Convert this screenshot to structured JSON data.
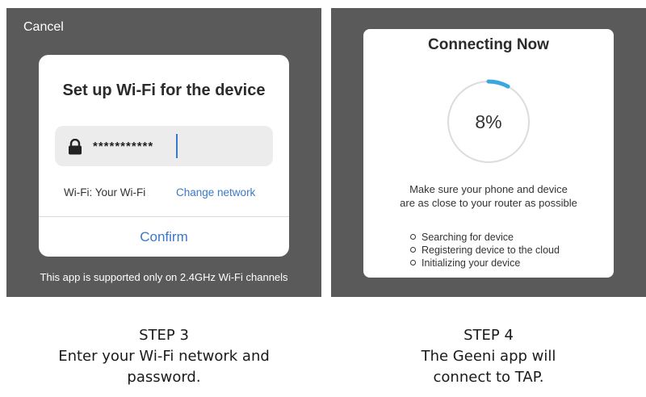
{
  "step3": {
    "cancel_label": "Cancel",
    "dialog_title": "Set up Wi-Fi for the device",
    "password_masked": "***********",
    "wifi_label": "Wi-Fi: Your Wi-Fi",
    "change_network_label": "Change network",
    "confirm_label": "Confirm",
    "footnote": "This app is supported only on 2.4GHz Wi-Fi channels"
  },
  "step4": {
    "title": "Connecting Now",
    "progress_text": "8%",
    "progress_value": 8,
    "note_line1": "Make sure your phone and device",
    "note_line2": "are as close to your router as possible",
    "steps": [
      "Searching for device",
      "Registering device to the cloud",
      "Initializing your device"
    ]
  },
  "captions": {
    "left_step": "STEP 3",
    "left_text": "Enter your Wi-Fi network and password.",
    "right_step": "STEP 4",
    "right_text": "The Geeni app will connect to TAP."
  },
  "colors": {
    "panel_bg": "#5a5a5a",
    "accent_blue": "#3a78c9",
    "progress_arc": "#3aa7e0",
    "progress_track": "#dcdcdc"
  },
  "icons": {
    "lock": "lock-icon",
    "bullet": "circle-bullet-icon"
  }
}
